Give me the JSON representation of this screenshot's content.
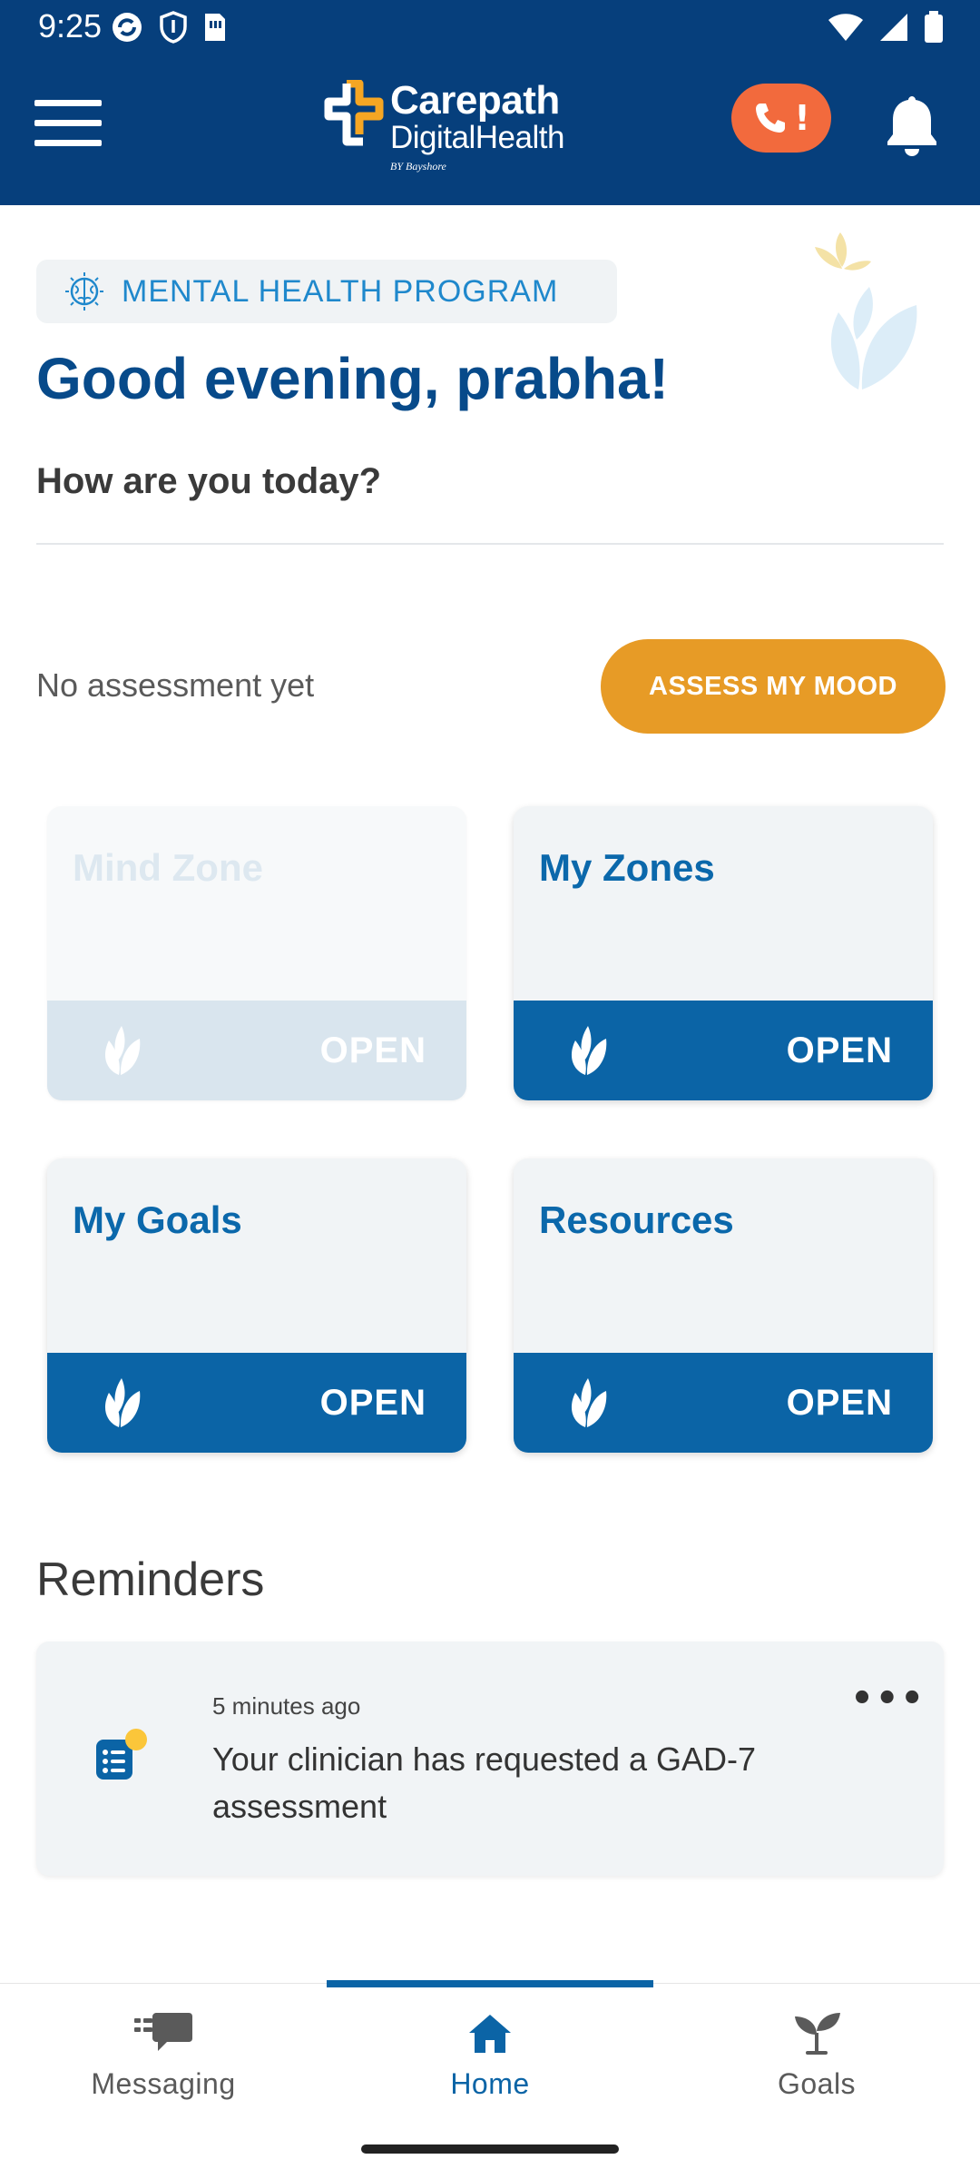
{
  "status_bar": {
    "time": "9:25"
  },
  "header": {
    "logo_title": "Carepath",
    "logo_subtitle": "DigitalHealth",
    "logo_by": "BY Bayshore",
    "call_badge": "!"
  },
  "program": {
    "label": "MENTAL HEALTH PROGRAM"
  },
  "greeting": "Good evening, prabha!",
  "mood": {
    "question": "How are you today?",
    "status": "No assessment yet",
    "button": "ASSESS MY MOOD"
  },
  "cards": [
    {
      "title": "Mind Zone",
      "action": "OPEN",
      "enabled": false
    },
    {
      "title": "My Zones",
      "action": "OPEN",
      "enabled": true
    },
    {
      "title": "My Goals",
      "action": "OPEN",
      "enabled": true
    },
    {
      "title": "Resources",
      "action": "OPEN",
      "enabled": true
    }
  ],
  "reminders": {
    "title": "Reminders",
    "items": [
      {
        "time": "5 minutes ago",
        "text": "Your clinician has requested a GAD-7 assessment",
        "menu": "•••"
      }
    ]
  },
  "nav": {
    "items": [
      {
        "label": "Messaging",
        "icon": "chat-icon",
        "active": false
      },
      {
        "label": "Home",
        "icon": "home-icon",
        "active": true
      },
      {
        "label": "Goals",
        "icon": "sprout-icon",
        "active": false
      }
    ]
  },
  "colors": {
    "brand_dark": "#063f7c",
    "brand_blue": "#0b64a6",
    "accent_orange": "#e79b26",
    "alert_orange": "#f26a3d"
  }
}
